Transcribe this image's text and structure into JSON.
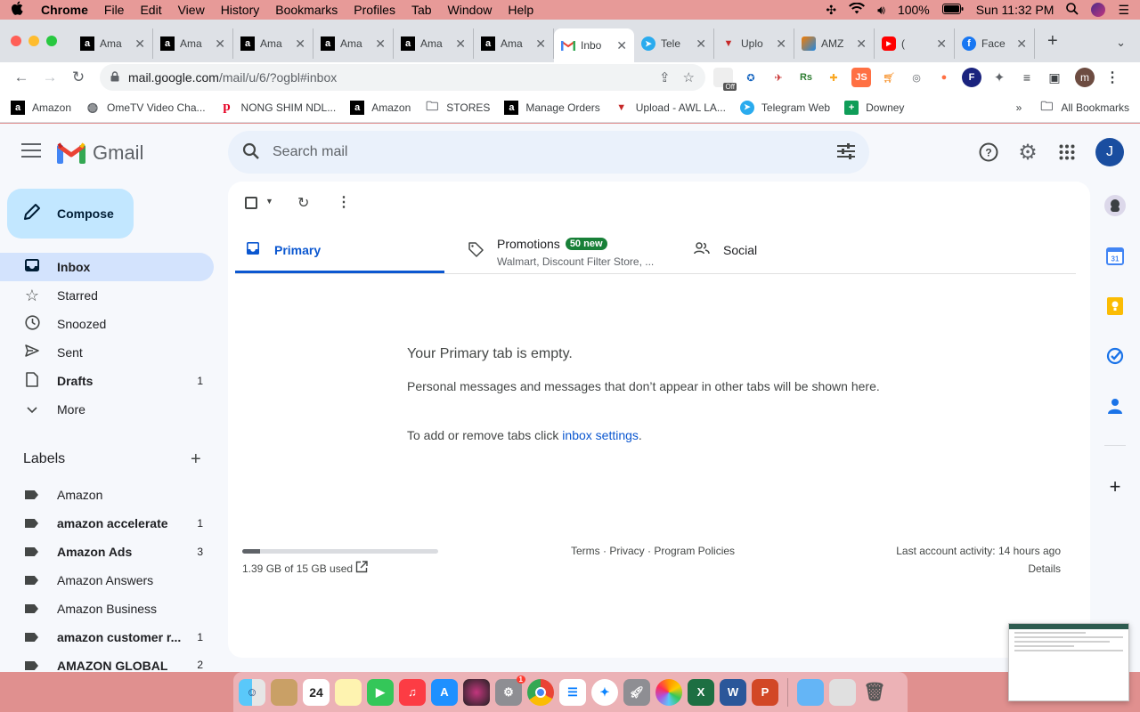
{
  "menubar": {
    "items": [
      "Chrome",
      "File",
      "Edit",
      "View",
      "History",
      "Bookmarks",
      "Profiles",
      "Tab",
      "Window",
      "Help"
    ],
    "battery": "100%",
    "clock": "Sun 11:32 PM"
  },
  "tabs": [
    {
      "title": "Ama",
      "icon": "amazon-icon"
    },
    {
      "title": "Ama",
      "icon": "amazon-icon"
    },
    {
      "title": "Ama",
      "icon": "amazon-icon"
    },
    {
      "title": "Ama",
      "icon": "amazon-icon"
    },
    {
      "title": "Ama",
      "icon": "amazon-icon"
    },
    {
      "title": "Ama",
      "icon": "amazon-icon"
    },
    {
      "title": "Inbo",
      "icon": "gmail-icon",
      "active": true
    },
    {
      "title": "Tele",
      "icon": "telegram-icon"
    },
    {
      "title": "Uplo",
      "icon": "awl-icon"
    },
    {
      "title": "AMZ",
      "icon": "amz-icon"
    },
    {
      "title": "(",
      "icon": "youtube-icon"
    },
    {
      "title": "Face",
      "icon": "facebook-icon"
    }
  ],
  "toolbar": {
    "url_host": "mail.google.com",
    "url_path": "/mail/u/6/?ogbl#inbox",
    "profile_initial": "m",
    "ext_badge": "Off"
  },
  "bookmarks": {
    "items": [
      {
        "label": "Amazon",
        "icon": "amazon-icon"
      },
      {
        "label": "OmeTV Video Cha...",
        "icon": "globe-icon"
      },
      {
        "label": "NONG SHIM NDL...",
        "icon": "pinterest-icon"
      },
      {
        "label": "Amazon",
        "icon": "amazon-icon"
      },
      {
        "label": "STORES",
        "icon": "folder-icon"
      },
      {
        "label": "Manage Orders",
        "icon": "amazon-icon"
      },
      {
        "label": "Upload - AWL LA...",
        "icon": "awl-icon"
      },
      {
        "label": "Telegram Web",
        "icon": "telegram-icon"
      },
      {
        "label": "Downey",
        "icon": "sheets-icon"
      }
    ],
    "more": "»",
    "all": "All Bookmarks"
  },
  "gmail": {
    "app_name": "Gmail",
    "search_placeholder": "Search mail",
    "avatar_initial": "J",
    "compose_label": "Compose",
    "nav": [
      {
        "label": "Inbox",
        "icon": "inbox-icon",
        "count": "",
        "active": true
      },
      {
        "label": "Starred",
        "icon": "star-icon",
        "count": ""
      },
      {
        "label": "Snoozed",
        "icon": "clock-icon",
        "count": ""
      },
      {
        "label": "Sent",
        "icon": "send-icon",
        "count": ""
      },
      {
        "label": "Drafts",
        "icon": "draft-icon",
        "count": "1",
        "bold": true
      },
      {
        "label": "More",
        "icon": "chevron-down-icon",
        "count": ""
      }
    ],
    "labels_title": "Labels",
    "labels": [
      {
        "label": "Amazon",
        "count": ""
      },
      {
        "label": "amazon accelerate",
        "count": "1",
        "bold": true
      },
      {
        "label": "Amazon Ads",
        "count": "3",
        "bold": true
      },
      {
        "label": "Amazon Answers",
        "count": ""
      },
      {
        "label": "Amazon Business",
        "count": ""
      },
      {
        "label": "amazon customer r...",
        "count": "1",
        "bold": true
      },
      {
        "label": "AMAZON GLOBAL",
        "count": "2",
        "bold": true
      }
    ],
    "categories": {
      "primary": "Primary",
      "promotions": "Promotions",
      "promotions_badge": "50 new",
      "promotions_senders": "Walmart, Discount Filter Store, ...",
      "social": "Social"
    },
    "empty": {
      "title": "Your Primary tab is empty.",
      "desc": "Personal messages and messages that don’t appear in other tabs will be shown here.",
      "settings_prefix": "To add or remove tabs click",
      "settings_link": "inbox settings",
      "settings_suffix": "."
    },
    "footer": {
      "storage": "1.39 GB of 15 GB used",
      "storage_fraction": 0.093,
      "links": "Terms · Privacy · Program Policies",
      "activity": "Last account activity: 14 hours ago",
      "details": "Details"
    }
  },
  "dock": {
    "calendar_day": "24",
    "settings_badge": "1"
  },
  "colors": {
    "accent": "#0b57d0",
    "compose": "#c2e7ff",
    "active_nav": "#d3e3fd",
    "badge_green": "#188038"
  }
}
